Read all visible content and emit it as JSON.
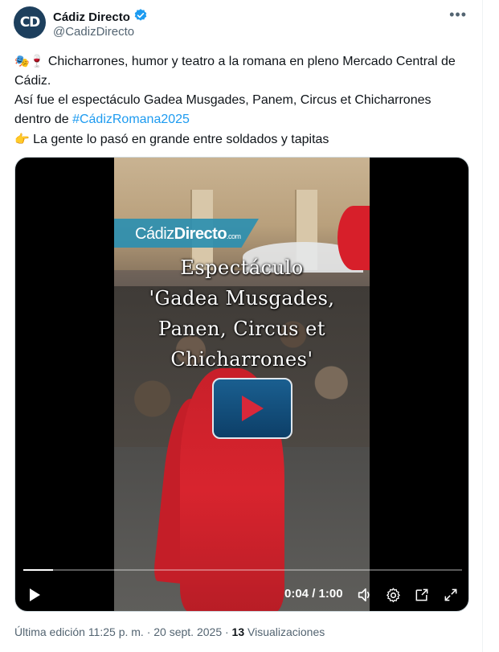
{
  "author": {
    "display_name": "Cádiz Directo",
    "handle": "@CadizDirecto",
    "avatar_text": "CD",
    "verified": true
  },
  "post": {
    "line1": "Chicharrones, humor y teatro a la romana en pleno Mercado Central de Cádiz.",
    "line2": "Así fue el espectáculo Gadea Musgades, Panem, Circus et Chicharrones",
    "line3_prefix": "dentro de ",
    "hashtag": "#CádizRomana2025",
    "line4": "La gente lo pasó en grande entre soldados y tapitas"
  },
  "video": {
    "logo_main": "Cádiz",
    "logo_bold": "Directo",
    "logo_suffix": ".com",
    "overlay_title": [
      "Espectáculo",
      "'Gadea Musgades,",
      "Panen, Circus et",
      "Chicharrones'"
    ],
    "current_time": "0:04",
    "duration": "1:00",
    "time_display": "0:04 / 1:00",
    "progress": 0.067
  },
  "footer": {
    "edited": "Última edición 11:25 p. m. · 20 sept. 2025 · ",
    "views_count": "13",
    "views_label": " Visualizaciones"
  },
  "colors": {
    "accent": "#1d9bf0",
    "muted": "#536471",
    "text": "#0f1419"
  },
  "icons": {
    "verified": "verified-badge-icon",
    "more": "more-options-icon",
    "play_overlay": "play-overlay-icon",
    "play": "play-icon",
    "volume": "volume-icon",
    "settings": "settings-gear-icon",
    "popout": "popout-icon",
    "fullscreen": "fullscreen-icon"
  }
}
